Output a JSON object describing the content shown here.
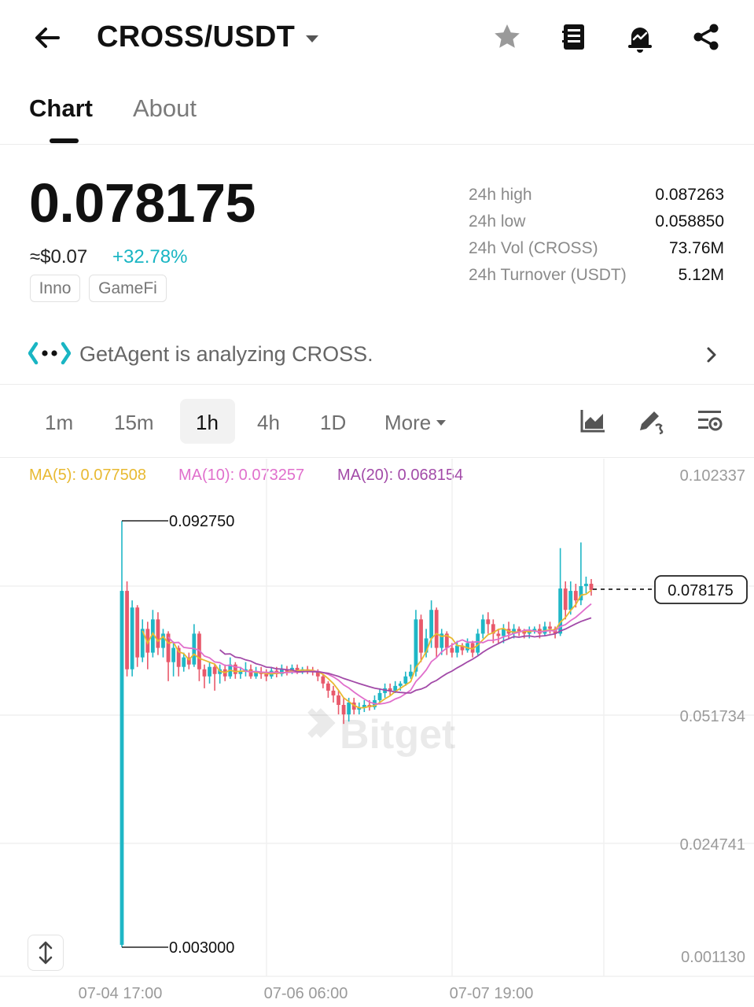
{
  "header": {
    "pair": "CROSS/USDT",
    "icons": [
      "back-arrow-icon",
      "caret-down-icon",
      "star-icon",
      "book-icon",
      "alert-bell-icon",
      "share-icon"
    ]
  },
  "tabs": [
    {
      "label": "Chart",
      "active": true
    },
    {
      "label": "About",
      "active": false
    }
  ],
  "price": {
    "last": "0.078175",
    "usd": "≈$0.07",
    "change": "+32.78%",
    "change_color": "#19b5c3",
    "tags": [
      "Inno",
      "GameFi"
    ]
  },
  "stats": [
    {
      "label": "24h high",
      "value": "0.087263"
    },
    {
      "label": "24h low",
      "value": "0.058850"
    },
    {
      "label": "24h Vol (CROSS)",
      "value": "73.76M"
    },
    {
      "label": "24h Turnover (USDT)",
      "value": "5.12M"
    }
  ],
  "agent": {
    "text": "GetAgent is analyzing CROSS.",
    "accent": "#19b5c3"
  },
  "intervals": {
    "items": [
      "1m",
      "15m",
      "1h",
      "4h",
      "1D"
    ],
    "active": "1h",
    "more": "More",
    "tool_icons": [
      "chart-type-icon",
      "drawing-pen-icon",
      "indicator-settings-icon"
    ]
  },
  "chart": {
    "ma": [
      {
        "label": "MA(5): 0.077508",
        "color": "#e8b931"
      },
      {
        "label": "MA(10): 0.073257",
        "color": "#e06fcc"
      },
      {
        "label": "MA(20): 0.068154",
        "color": "#a24aa8"
      }
    ],
    "high_marker": "0.092750",
    "low_marker": "0.003000",
    "current_price_label": "0.078175",
    "watermark": "Bitget",
    "fullscreen_icon": "vertical-resize-icon",
    "up_color": "#1fb7c6",
    "down_color": "#e8596b"
  },
  "chart_data": {
    "type": "candlestick",
    "y_axis_ticks": [
      "0.102337",
      "0.051734",
      "0.024741",
      "0.001130"
    ],
    "x_axis_ticks": [
      "07-04 17:00",
      "07-06 06:00",
      "07-07 19:00"
    ],
    "ylim": [
      0.00113,
      0.102337
    ],
    "series": [
      {
        "name": "MA(5)",
        "last": 0.077508
      },
      {
        "name": "MA(10)",
        "last": 0.073257
      },
      {
        "name": "MA(20)",
        "last": 0.068154
      }
    ],
    "candles": [
      [
        0.0035,
        0.078,
        0.0927,
        0.003
      ],
      [
        0.078,
        0.0615,
        0.08,
        0.06
      ],
      [
        0.0615,
        0.0745,
        0.076,
        0.06
      ],
      [
        0.0745,
        0.064,
        0.075,
        0.062
      ],
      [
        0.064,
        0.07,
        0.072,
        0.063
      ],
      [
        0.07,
        0.065,
        0.0715,
        0.0615
      ],
      [
        0.065,
        0.072,
        0.074,
        0.064
      ],
      [
        0.072,
        0.066,
        0.0735,
        0.0645
      ],
      [
        0.066,
        0.069,
        0.07,
        0.064
      ],
      [
        0.069,
        0.063,
        0.0695,
        0.059
      ],
      [
        0.063,
        0.066,
        0.067,
        0.06
      ],
      [
        0.066,
        0.062,
        0.0665,
        0.06
      ],
      [
        0.062,
        0.064,
        0.065,
        0.061
      ],
      [
        0.064,
        0.0625,
        0.065,
        0.0615
      ],
      [
        0.0625,
        0.069,
        0.071,
        0.062
      ],
      [
        0.069,
        0.0615,
        0.0695,
        0.059
      ],
      [
        0.0615,
        0.06,
        0.0625,
        0.0575
      ],
      [
        0.06,
        0.062,
        0.063,
        0.0585
      ],
      [
        0.062,
        0.0605,
        0.0625,
        0.057
      ],
      [
        0.0605,
        0.0615,
        0.0625,
        0.0585
      ],
      [
        0.0615,
        0.06,
        0.0625,
        0.059
      ],
      [
        0.06,
        0.0625,
        0.064,
        0.0595
      ],
      [
        0.0625,
        0.0605,
        0.063,
        0.0595
      ],
      [
        0.0605,
        0.061,
        0.062,
        0.0595
      ],
      [
        0.061,
        0.0615,
        0.063,
        0.06
      ],
      [
        0.0615,
        0.06,
        0.0625,
        0.0595
      ],
      [
        0.06,
        0.061,
        0.062,
        0.0595
      ],
      [
        0.061,
        0.0605,
        0.062,
        0.0595
      ],
      [
        0.0605,
        0.06,
        0.0615,
        0.059
      ],
      [
        0.06,
        0.0612,
        0.062,
        0.0595
      ],
      [
        0.0612,
        0.0605,
        0.062,
        0.0598
      ],
      [
        0.0605,
        0.0615,
        0.0625,
        0.06
      ],
      [
        0.0615,
        0.061,
        0.0622,
        0.0602
      ],
      [
        0.061,
        0.0618,
        0.0625,
        0.0605
      ],
      [
        0.0618,
        0.061,
        0.0625,
        0.0605
      ],
      [
        0.061,
        0.0615,
        0.062,
        0.0605
      ],
      [
        0.0615,
        0.0612,
        0.0622,
        0.0605
      ],
      [
        0.0612,
        0.061,
        0.062,
        0.0602
      ],
      [
        0.061,
        0.06,
        0.0615,
        0.059
      ],
      [
        0.06,
        0.0585,
        0.0605,
        0.0575
      ],
      [
        0.0585,
        0.057,
        0.059,
        0.0555
      ],
      [
        0.057,
        0.056,
        0.058,
        0.0545
      ],
      [
        0.056,
        0.054,
        0.057,
        0.052
      ],
      [
        0.054,
        0.052,
        0.0555,
        0.05
      ],
      [
        0.052,
        0.0545,
        0.0555,
        0.0505
      ],
      [
        0.0545,
        0.053,
        0.0555,
        0.052
      ],
      [
        0.053,
        0.0535,
        0.0545,
        0.052
      ],
      [
        0.0535,
        0.054,
        0.055,
        0.0525
      ],
      [
        0.054,
        0.0535,
        0.055,
        0.0528
      ],
      [
        0.0535,
        0.055,
        0.056,
        0.053
      ],
      [
        0.055,
        0.0565,
        0.0575,
        0.0545
      ],
      [
        0.0565,
        0.0575,
        0.0585,
        0.0555
      ],
      [
        0.0575,
        0.057,
        0.0585,
        0.056
      ],
      [
        0.057,
        0.058,
        0.059,
        0.0565
      ],
      [
        0.058,
        0.0585,
        0.059,
        0.057
      ],
      [
        0.0585,
        0.06,
        0.061,
        0.058
      ],
      [
        0.06,
        0.061,
        0.0625,
        0.0595
      ],
      [
        0.061,
        0.072,
        0.074,
        0.06
      ],
      [
        0.072,
        0.065,
        0.073,
        0.063
      ],
      [
        0.065,
        0.068,
        0.07,
        0.064
      ],
      [
        0.068,
        0.074,
        0.076,
        0.066
      ],
      [
        0.074,
        0.066,
        0.0745,
        0.064
      ],
      [
        0.066,
        0.069,
        0.07,
        0.0645
      ],
      [
        0.069,
        0.066,
        0.0695,
        0.0645
      ],
      [
        0.066,
        0.065,
        0.067,
        0.064
      ],
      [
        0.065,
        0.0665,
        0.0675,
        0.064
      ],
      [
        0.0665,
        0.0655,
        0.067,
        0.0645
      ],
      [
        0.0655,
        0.067,
        0.068,
        0.065
      ],
      [
        0.067,
        0.065,
        0.0675,
        0.064
      ],
      [
        0.065,
        0.069,
        0.07,
        0.0645
      ],
      [
        0.069,
        0.072,
        0.073,
        0.068
      ],
      [
        0.072,
        0.071,
        0.0735,
        0.069
      ],
      [
        0.071,
        0.069,
        0.072,
        0.067
      ],
      [
        0.069,
        0.0685,
        0.07,
        0.067
      ],
      [
        0.0685,
        0.07,
        0.071,
        0.067
      ],
      [
        0.07,
        0.069,
        0.0715,
        0.068
      ],
      [
        0.069,
        0.07,
        0.071,
        0.068
      ],
      [
        0.07,
        0.0695,
        0.0705,
        0.0685
      ],
      [
        0.0695,
        0.069,
        0.07,
        0.068
      ],
      [
        0.069,
        0.0695,
        0.0705,
        0.068
      ],
      [
        0.0695,
        0.07,
        0.0705,
        0.069
      ],
      [
        0.07,
        0.069,
        0.071,
        0.068
      ],
      [
        0.069,
        0.0705,
        0.0715,
        0.0685
      ],
      [
        0.0705,
        0.07,
        0.0715,
        0.069
      ],
      [
        0.07,
        0.069,
        0.0705,
        0.068
      ],
      [
        0.069,
        0.0785,
        0.087,
        0.0685
      ],
      [
        0.0785,
        0.074,
        0.08,
        0.072
      ],
      [
        0.074,
        0.078,
        0.08,
        0.073
      ],
      [
        0.078,
        0.076,
        0.0795,
        0.0745
      ],
      [
        0.076,
        0.079,
        0.0882,
        0.075
      ],
      [
        0.079,
        0.0795,
        0.081,
        0.0775
      ],
      [
        0.0795,
        0.0782,
        0.0805,
        0.077
      ]
    ]
  }
}
